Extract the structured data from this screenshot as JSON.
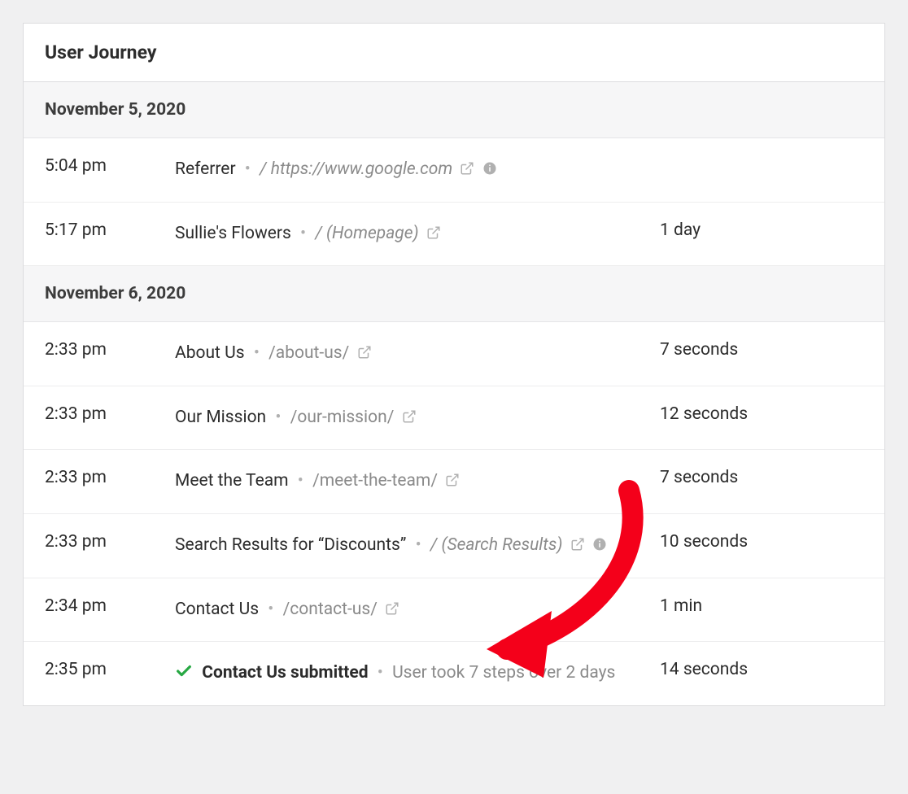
{
  "panel": {
    "title": "User Journey"
  },
  "days": [
    {
      "label": "November 5, 2020",
      "rows": [
        {
          "time": "5:04 pm",
          "title": "Referrer",
          "sep": "•",
          "slash": "/",
          "path": "https://www.google.com",
          "path_italic": true,
          "has_ext": true,
          "has_info": true,
          "duration": ""
        },
        {
          "time": "5:17 pm",
          "title": "Sullie's Flowers",
          "sep": "•",
          "slash": "/",
          "path": "(Homepage)",
          "path_italic": true,
          "has_ext": true,
          "has_info": false,
          "duration": "1 day"
        }
      ]
    },
    {
      "label": "November 6, 2020",
      "rows": [
        {
          "time": "2:33 pm",
          "title": "About Us",
          "sep": "•",
          "slash": "",
          "path": "/about-us/",
          "path_italic": false,
          "has_ext": true,
          "has_info": false,
          "duration": "7 seconds"
        },
        {
          "time": "2:33 pm",
          "title": "Our Mission",
          "sep": "•",
          "slash": "",
          "path": "/our-mission/",
          "path_italic": false,
          "has_ext": true,
          "has_info": false,
          "duration": "12 seconds"
        },
        {
          "time": "2:33 pm",
          "title": "Meet the Team",
          "sep": "•",
          "slash": "",
          "path": "/meet-the-team/",
          "path_italic": false,
          "has_ext": true,
          "has_info": false,
          "duration": "7 seconds"
        },
        {
          "time": "2:33 pm",
          "title": "Search Results for “Discounts”",
          "sep": "•",
          "slash": "/",
          "path": "(Search Results)",
          "path_italic": true,
          "has_ext": true,
          "has_info": true,
          "duration": "10 seconds"
        },
        {
          "time": "2:34 pm",
          "title": "Contact Us",
          "sep": "•",
          "slash": "",
          "path": "/contact-us/",
          "path_italic": false,
          "has_ext": true,
          "has_info": false,
          "duration": "1 min"
        },
        {
          "time": "2:35 pm",
          "title": "Contact Us submitted",
          "title_bold": true,
          "check": true,
          "sep": "•",
          "note": "User took 7 steps over 2 days",
          "duration": "14 seconds"
        }
      ]
    }
  ],
  "annotation": {
    "arrow_color": "#f4001a"
  }
}
